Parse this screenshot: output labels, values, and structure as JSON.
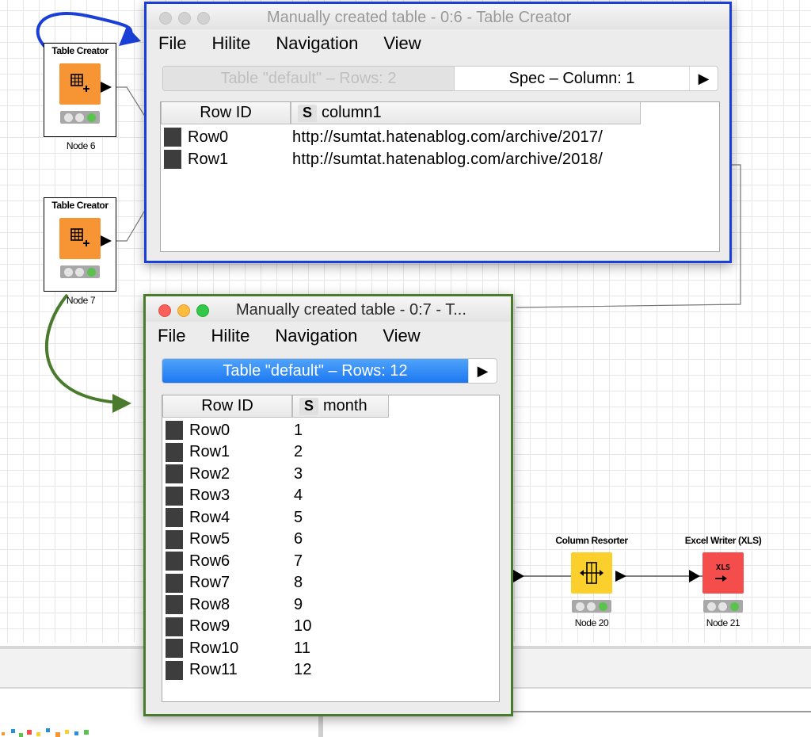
{
  "workflow": {
    "nodes": [
      {
        "id": "node6",
        "title": "Table Creator",
        "label": "Node 6",
        "color": "#f79433",
        "icon": "table-creator-icon"
      },
      {
        "id": "node7",
        "title": "Table Creator",
        "label": "Node 7",
        "color": "#f79433",
        "icon": "table-creator-icon"
      },
      {
        "id": "node20",
        "title": "Column Resorter",
        "label": "Node 20",
        "color": "#fcd02c",
        "icon": "column-resorter-icon"
      },
      {
        "id": "node21",
        "title": "Excel Writer (XLS)",
        "label": "Node 21",
        "color": "#f54c4c",
        "icon": "excel-writer-icon",
        "icon_text": "XLS"
      }
    ]
  },
  "window_top": {
    "title": "Manually created table - 0:6 - Table Creator",
    "highlight_color": "#1a3fd6",
    "menu": [
      "File",
      "Hilite",
      "Navigation",
      "View"
    ],
    "tabs": [
      {
        "label": "Table \"default\" – Rows: 2",
        "active": false
      },
      {
        "label": "Spec – Column: 1",
        "active": true
      }
    ],
    "tab_arrow": "▶",
    "columns": [
      "Row ID",
      "column1"
    ],
    "type_badge": "S",
    "rows": [
      {
        "id": "Row0",
        "value": "http://sumtat.hatenablog.com/archive/2017/"
      },
      {
        "id": "Row1",
        "value": "http://sumtat.hatenablog.com/archive/2018/"
      }
    ]
  },
  "window_bottom": {
    "title": "Manually created table - 0:7 - T...",
    "highlight_color": "#4a7a2c",
    "menu": [
      "File",
      "Hilite",
      "Navigation",
      "View"
    ],
    "tabs": [
      {
        "label": "Table \"default\" – Rows: 12",
        "active": true
      }
    ],
    "tab_arrow": "▶",
    "columns": [
      "Row ID",
      "month"
    ],
    "type_badge": "S",
    "rows": [
      {
        "id": "Row0",
        "value": "1"
      },
      {
        "id": "Row1",
        "value": "2"
      },
      {
        "id": "Row2",
        "value": "3"
      },
      {
        "id": "Row3",
        "value": "4"
      },
      {
        "id": "Row4",
        "value": "5"
      },
      {
        "id": "Row5",
        "value": "6"
      },
      {
        "id": "Row6",
        "value": "7"
      },
      {
        "id": "Row7",
        "value": "8"
      },
      {
        "id": "Row8",
        "value": "9"
      },
      {
        "id": "Row9",
        "value": "10"
      },
      {
        "id": "Row10",
        "value": "11"
      },
      {
        "id": "Row11",
        "value": "12"
      }
    ]
  }
}
